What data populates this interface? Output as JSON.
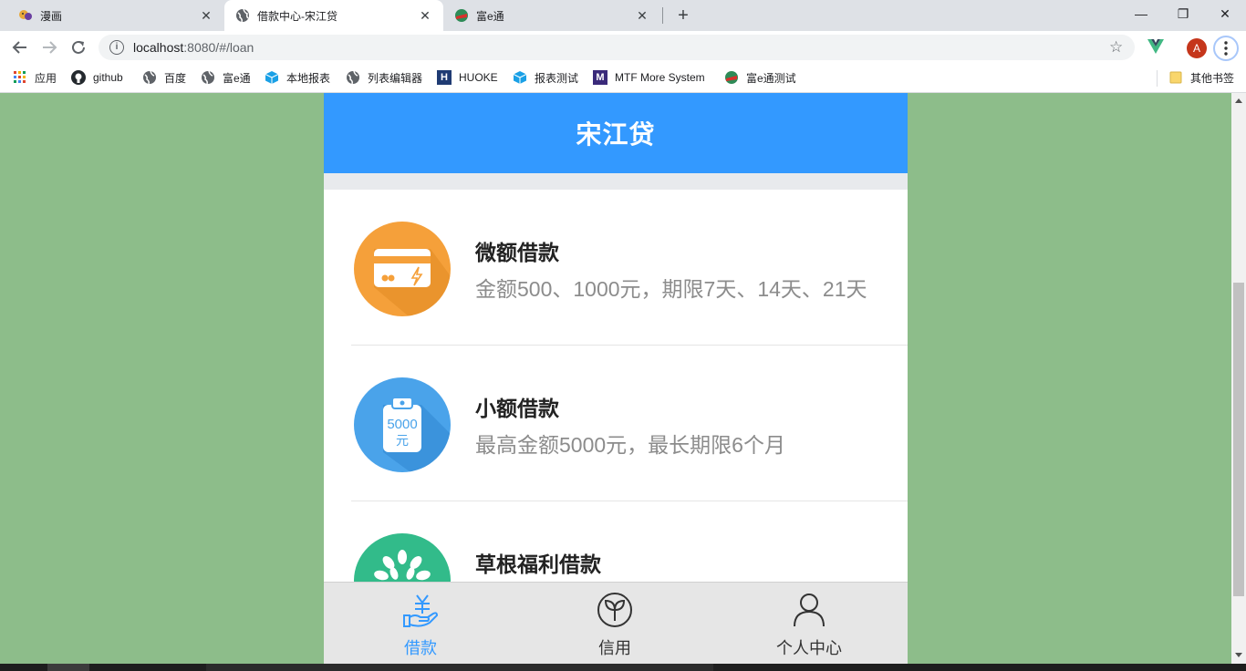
{
  "browser": {
    "tabs": [
      {
        "title": "漫画",
        "close": "✕"
      },
      {
        "title": "借款中心-宋江贷",
        "close": "✕"
      },
      {
        "title": "富e通",
        "close": "✕"
      }
    ],
    "new_tab": "+",
    "window_controls": {
      "minimize": "—",
      "maximize": "❐",
      "close": "✕"
    },
    "address": {
      "host": "localhost",
      "path": ":8080/#/loan"
    },
    "profile_initial": "A",
    "bookmarks": [
      {
        "label": "应用"
      },
      {
        "label": "github"
      },
      {
        "label": "百度"
      },
      {
        "label": "富e通"
      },
      {
        "label": "本地报表"
      },
      {
        "label": "列表编辑器"
      },
      {
        "label": "HUOKE"
      },
      {
        "label": "报表测试"
      },
      {
        "label": "MTF More System"
      },
      {
        "label": "富e通测试"
      }
    ],
    "other_bookmarks": "其他书签"
  },
  "app": {
    "title": "宋江贷",
    "loans": [
      {
        "name": "微额借款",
        "desc": "金额500、1000元，期限7天、14天、21天",
        "icon": "credit-card-icon",
        "color": "#f5a03a"
      },
      {
        "name": "小额借款",
        "desc": "最高金额5000元，最长期限6个月",
        "icon": "clipboard-5000-icon",
        "color": "#4aa3ea",
        "icon_text": [
          "5000",
          "元"
        ]
      },
      {
        "name": "草根福利借款",
        "desc": "",
        "icon": "tree-icon",
        "color": "#32bb8a"
      }
    ],
    "tabbar": [
      {
        "label": "借款",
        "icon": "yuan-hand-icon",
        "active": true
      },
      {
        "label": "信用",
        "icon": "sprout-icon",
        "active": false
      },
      {
        "label": "个人中心",
        "icon": "person-icon",
        "active": false
      }
    ],
    "accent": "#3399ff"
  }
}
